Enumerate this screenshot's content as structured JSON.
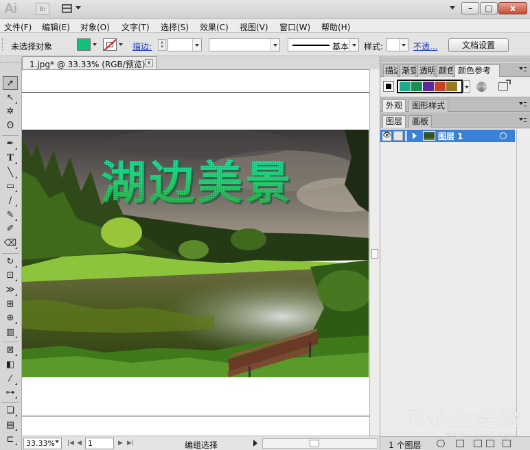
{
  "app": {
    "logo": "Ai",
    "bridge": "Br"
  },
  "menu": [
    "文件(F)",
    "编辑(E)",
    "对象(O)",
    "文字(T)",
    "选择(S)",
    "效果(C)",
    "视图(V)",
    "窗口(W)",
    "帮助(H)"
  ],
  "control": {
    "selection": "未选择对象",
    "stroke_label": "描边:",
    "stroke_style": "基本",
    "style_label": "样式:",
    "opacity_link": "不透...",
    "doc_setup": "文档设置",
    "fill_color": "#12c07a"
  },
  "window": {
    "close": "x",
    "maximize": "□",
    "minimize": "–"
  },
  "document": {
    "tab": "1.jpg* @ 33.33% (RGB/预览)",
    "close": "x",
    "title_art": "湖边美景"
  },
  "status": {
    "zoom": "33.33%",
    "page": "1",
    "text": "编组选择"
  },
  "panels": {
    "top_tabs": [
      "描边",
      "渐变",
      "透明",
      "颜色",
      "颜色参考"
    ],
    "harmony_colors": [
      "#1fa88a",
      "#1e8c55",
      "#5a2a9a",
      "#c6402c",
      "#9a7a20"
    ],
    "mid_tabs": [
      "外观",
      "图形样式"
    ],
    "layer_tabs": [
      "图层",
      "画板"
    ],
    "layer_name": "图层 1",
    "layer_count": "1 个图层",
    "eye": "👁"
  },
  "watermark": {
    "text": "Baidu经验",
    "sub": "jingyan.baidu.com"
  }
}
